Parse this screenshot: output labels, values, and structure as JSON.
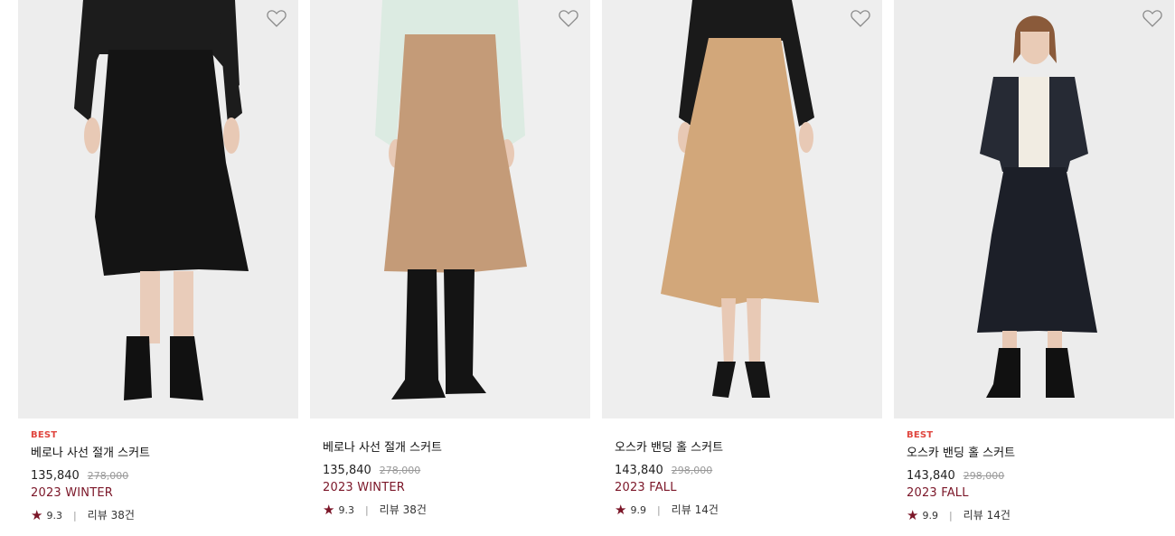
{
  "icons": {
    "wishlist": "heart-outline-icon",
    "rating": "star-icon"
  },
  "colors": {
    "badge": "#e0463f",
    "season": "#7b1628",
    "star": "#7b1628",
    "price": "#222222",
    "original_price": "#999999"
  },
  "products": [
    {
      "badge": "BEST",
      "name": "베로나 사선 절개 스커트",
      "price": "135,840",
      "original_price": "278,000",
      "season": "2023 WINTER",
      "star": "★",
      "rating": "9.3",
      "sep": "|",
      "review_label": "리뷰",
      "review_count": "38건"
    },
    {
      "badge": "",
      "name": "베로나 사선 절개 스커트",
      "price": "135,840",
      "original_price": "278,000",
      "season": "2023 WINTER",
      "star": "★",
      "rating": "9.3",
      "sep": "|",
      "review_label": "리뷰",
      "review_count": "38건"
    },
    {
      "badge": "",
      "name": "오스카 밴딩 홀 스커트",
      "price": "143,840",
      "original_price": "298,000",
      "season": "2023 FALL",
      "star": "★",
      "rating": "9.9",
      "sep": "|",
      "review_label": "리뷰",
      "review_count": "14건"
    },
    {
      "badge": "BEST",
      "name": "오스카 밴딩 홀 스커트",
      "price": "143,840",
      "original_price": "298,000",
      "season": "2023 FALL",
      "star": "★",
      "rating": "9.9",
      "sep": "|",
      "review_label": "리뷰",
      "review_count": "14건"
    }
  ]
}
